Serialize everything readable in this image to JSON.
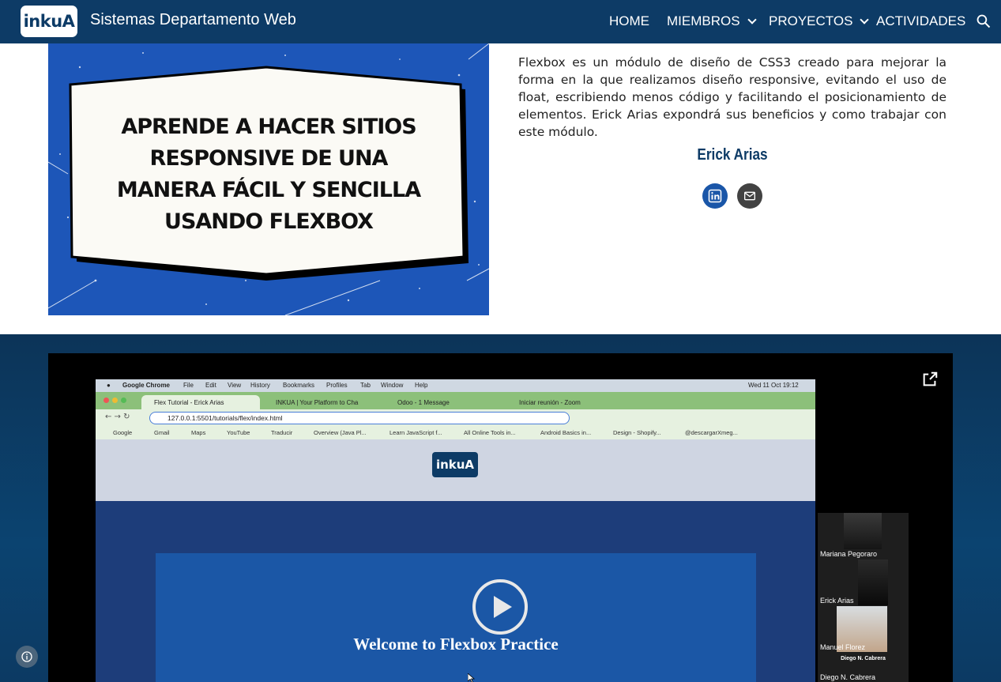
{
  "header": {
    "logo_text": "inkuA",
    "site_title": "Sistemas Departamento Web",
    "nav": [
      {
        "label": "HOME"
      },
      {
        "label": "MIEMBROS"
      },
      {
        "label": "PROYECTOS"
      },
      {
        "label": "ACTIVIDADES"
      }
    ],
    "search_icon": "search-icon"
  },
  "hero_image": {
    "lines": [
      "APRENDE A HACER SITIOS",
      "RESPONSIVE DE UNA",
      "MANERA FÁCIL Y SENCILLA",
      "USANDO FLEXBOX"
    ]
  },
  "description": "Flexbox es un módulo de diseño de CSS3 creado para mejorar la forma en la que realizamos diseño responsive, evitando el uso de float, escribiendo menos código y facilitando el posicionamiento de elementos. Erick Arias expondrá sus beneficios y como trabajar con este módulo.",
  "speaker": {
    "name": "Erick Arias",
    "icons": [
      "linkedin-icon",
      "email-icon"
    ]
  },
  "video": {
    "popout_icon": "open-in-new-icon",
    "mac_menu": [
      "Google Chrome",
      "File",
      "Edit",
      "View",
      "History",
      "Bookmarks",
      "Profiles",
      "Tab",
      "Window",
      "Help"
    ],
    "mac_clock": "Wed 11 Oct 19:12",
    "tabs": [
      {
        "label": "Flex Tutorial - Erick Arias"
      },
      {
        "label": "INKUA | Your Platform to Cha"
      },
      {
        "label": "Odoo - 1 Message"
      },
      {
        "label": "Iniciar reunión - Zoom"
      }
    ],
    "url": "127.0.0.1:5501/tutorials/flex/index.html",
    "bookmarks": [
      "Google",
      "Gmail",
      "Maps",
      "YouTube",
      "Traducir",
      "Overview (Java Pl...",
      "Learn JavaScript f...",
      "All Online Tools in...",
      "Android Basics in...",
      "Design - Shopify...",
      "@descargarXmeg..."
    ],
    "page_logo": "inkuA",
    "welcome": "Welcome to Flexbox Practice",
    "participants": [
      {
        "name": "Mariana Pegoraro"
      },
      {
        "name": "Erick Arias"
      },
      {
        "name": "Manuel Florez"
      },
      {
        "name": "Diego N. Cabrera",
        "caption": "Diego N. Cabrera"
      }
    ]
  },
  "colors": {
    "brand": "#0d3b66",
    "hero_bg": "#1d56b8",
    "linkedin": "#1a56a8",
    "email": "#424242"
  }
}
